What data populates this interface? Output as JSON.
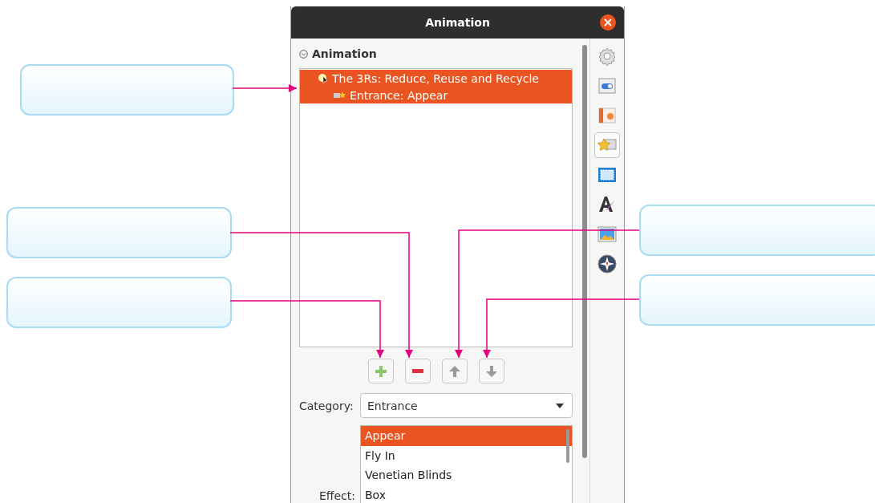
{
  "window": {
    "title": "Animation"
  },
  "section": {
    "title": "Animation",
    "expanded": true
  },
  "animation_list": [
    {
      "label": "The 3Rs: Reduce, Reuse and Recycle",
      "selected": true,
      "children": [
        {
          "label": "Entrance: Appear",
          "selected": true
        }
      ]
    }
  ],
  "list_buttons": [
    {
      "kind": "add"
    },
    {
      "kind": "remove"
    },
    {
      "kind": "up"
    },
    {
      "kind": "down"
    }
  ],
  "category": {
    "label": "Category:",
    "value": "Entrance"
  },
  "effect": {
    "label": "Effect:",
    "items": [
      {
        "label": "Appear",
        "selected": true
      },
      {
        "label": "Fly In",
        "selected": false
      },
      {
        "label": "Venetian Blinds",
        "selected": false
      },
      {
        "label": "Box",
        "selected": false
      }
    ]
  },
  "sidebar": {
    "items": [
      {
        "kind": "settings",
        "selected": false
      },
      {
        "kind": "properties",
        "selected": false
      },
      {
        "kind": "slides",
        "selected": false
      },
      {
        "kind": "animation",
        "selected": true
      },
      {
        "kind": "transition",
        "selected": false
      },
      {
        "kind": "styles",
        "selected": false
      },
      {
        "kind": "gallery",
        "selected": false
      },
      {
        "kind": "navigator",
        "selected": false
      }
    ]
  }
}
